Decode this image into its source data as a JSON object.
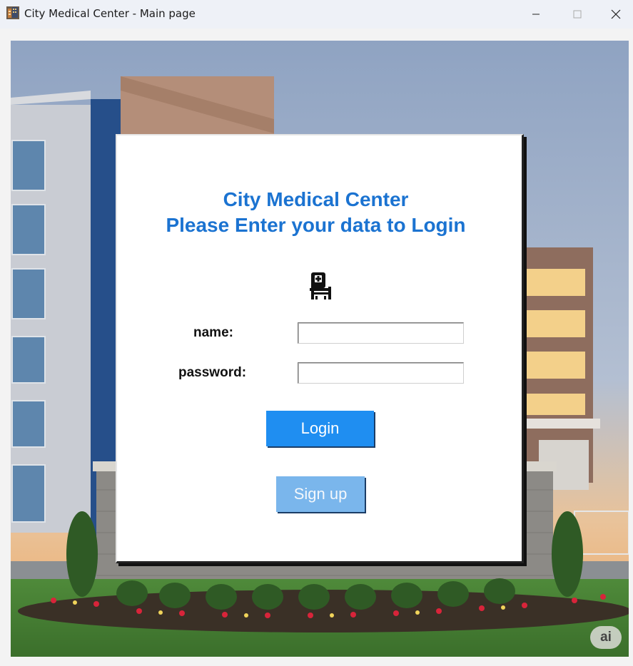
{
  "window": {
    "title": "City Medical Center - Main page"
  },
  "login_card": {
    "heading_line1": "City Medical Center",
    "heading_line2": "Please Enter your data to Login",
    "logo_icon": "hospital-bed-icon",
    "name_label": "name:",
    "name_value": "",
    "password_label": "password:",
    "password_value": "",
    "login_button": "Login",
    "signup_button": "Sign up"
  },
  "badge": {
    "text": "ai"
  },
  "colors": {
    "heading": "#1b73d1",
    "login_button": "#1f8ef1",
    "signup_button": "#7ab6ec",
    "titlebar": "#eef1f7"
  }
}
